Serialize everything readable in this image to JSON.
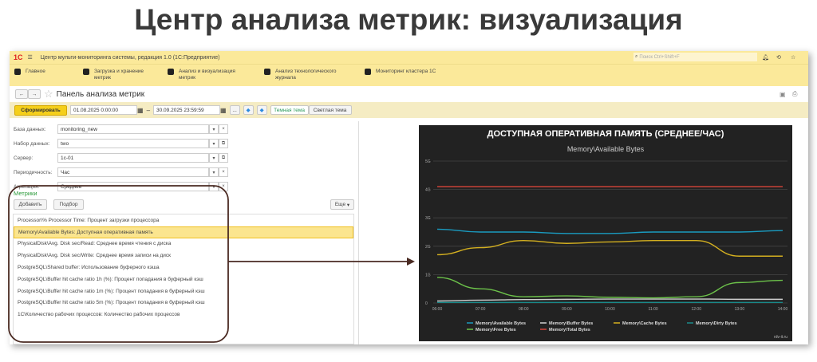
{
  "slide_title": "Центр анализа метрик: визуализация",
  "app": {
    "logo": "1С",
    "title": "Центр мульти-мониторинга системы, редакция 1.0  (1С:Предприятие)",
    "search_placeholder": "Поиск Ctrl+Shift+F"
  },
  "nav": [
    {
      "label": "Главное",
      "icon": "home-icon"
    },
    {
      "label": "Загрузка и хранение метрик",
      "icon": "briefcase-icon"
    },
    {
      "label": "Анализ и визуализация метрик",
      "icon": "chart-icon"
    },
    {
      "label": "Анализ технологического журнала",
      "icon": "log-icon"
    },
    {
      "label": "Мониторинг кластера 1С",
      "icon": "grid-icon"
    }
  ],
  "page": {
    "title": "Панель анализа метрик"
  },
  "toolbar": {
    "generate": "Сформировать",
    "date_from": "01.08.2025  0:00:00",
    "dash": "–",
    "date_to": "30.09.2025 23:59:59",
    "more": "...",
    "dark_theme": "Темная тема",
    "light_theme": "Светлая тема"
  },
  "form": [
    {
      "label": "База данных:",
      "value": "monitoring_new"
    },
    {
      "label": "Набор данных:",
      "value": "two"
    },
    {
      "label": "Сервер:",
      "value": "1c-01"
    },
    {
      "label": "Периодичность:",
      "value": "Час"
    },
    {
      "label": "Агрегация:",
      "value": "Среднее"
    }
  ],
  "metrics": {
    "title": "Метрики",
    "add": "Добавить",
    "pick": "Подбор",
    "more": "Еще",
    "items": [
      "Processor\\% Processor Time: Процент загрузки процессора",
      "Memory\\Available Bytes: Доступная оперативная память",
      "PhysicalDisk\\Avg. Disk sec/Read: Среднее время чтения с диска",
      "PhysicalDisk\\Avg. Disk sec/Write: Среднее время записи на диск",
      "PostgreSQL\\Shared buffer: Использование буферного кэша",
      "PostgreSQL\\Buffer hit cache ratio 1h (%): Процент попадания в буферный кэш",
      "PostgreSQL\\Buffer hit cache ratio 1m (%): Процент попадания в буферный кэш",
      "PostgreSQL\\Buffer hit cache ratio 5m (%): Процент попадания в буферный кэш",
      "1С\\Количество рабочих процессов: Количество рабочих процессов"
    ],
    "selected_index": 1
  },
  "chart_data": {
    "type": "line",
    "title": "ДОСТУПНАЯ ОПЕРАТИВНАЯ ПАМЯТЬ (СРЕДНЕЕ/ЧАС)",
    "subtitle": "Memory\\Available Bytes",
    "credit": "rdv-it.ru",
    "x": [
      "06:00",
      "07:00",
      "08:00",
      "09:00",
      "10:00",
      "11:00",
      "12:00",
      "13:00",
      "14:00"
    ],
    "yticks": [
      "0",
      "1G",
      "2G",
      "3G",
      "4G",
      "5G"
    ],
    "ylim": [
      0,
      5
    ],
    "yunit": "GB",
    "legend": "bottom",
    "series": [
      {
        "name": "Memory\\Available Bytes",
        "color": "#1a9bc0",
        "values": [
          2.6,
          2.5,
          2.5,
          2.45,
          2.45,
          2.5,
          2.5,
          2.5,
          2.55
        ]
      },
      {
        "name": "Memory\\Buffer Bytes",
        "color": "#cfcfcf",
        "values": [
          0.07,
          0.1,
          0.12,
          0.13,
          0.14,
          0.14,
          0.14,
          0.13,
          0.13
        ]
      },
      {
        "name": "Memory\\Cache Bytes",
        "color": "#d4b020",
        "values": [
          1.7,
          1.95,
          2.2,
          2.1,
          2.15,
          2.2,
          2.2,
          1.65,
          1.65
        ]
      },
      {
        "name": "Memory\\Dirty Bytes",
        "color": "#1a8a8a",
        "values": [
          0.02,
          0.02,
          0.02,
          0.02,
          0.02,
          0.02,
          0.02,
          0.02,
          0.02
        ]
      },
      {
        "name": "Memory\\Free Bytes",
        "color": "#6cc24a",
        "values": [
          0.9,
          0.5,
          0.22,
          0.25,
          0.2,
          0.18,
          0.22,
          0.72,
          0.8
        ]
      },
      {
        "name": "Memory\\Total Bytes",
        "color": "#d9443a",
        "values": [
          4.1,
          4.1,
          4.1,
          4.1,
          4.1,
          4.1,
          4.1,
          4.1,
          4.1
        ]
      }
    ]
  }
}
